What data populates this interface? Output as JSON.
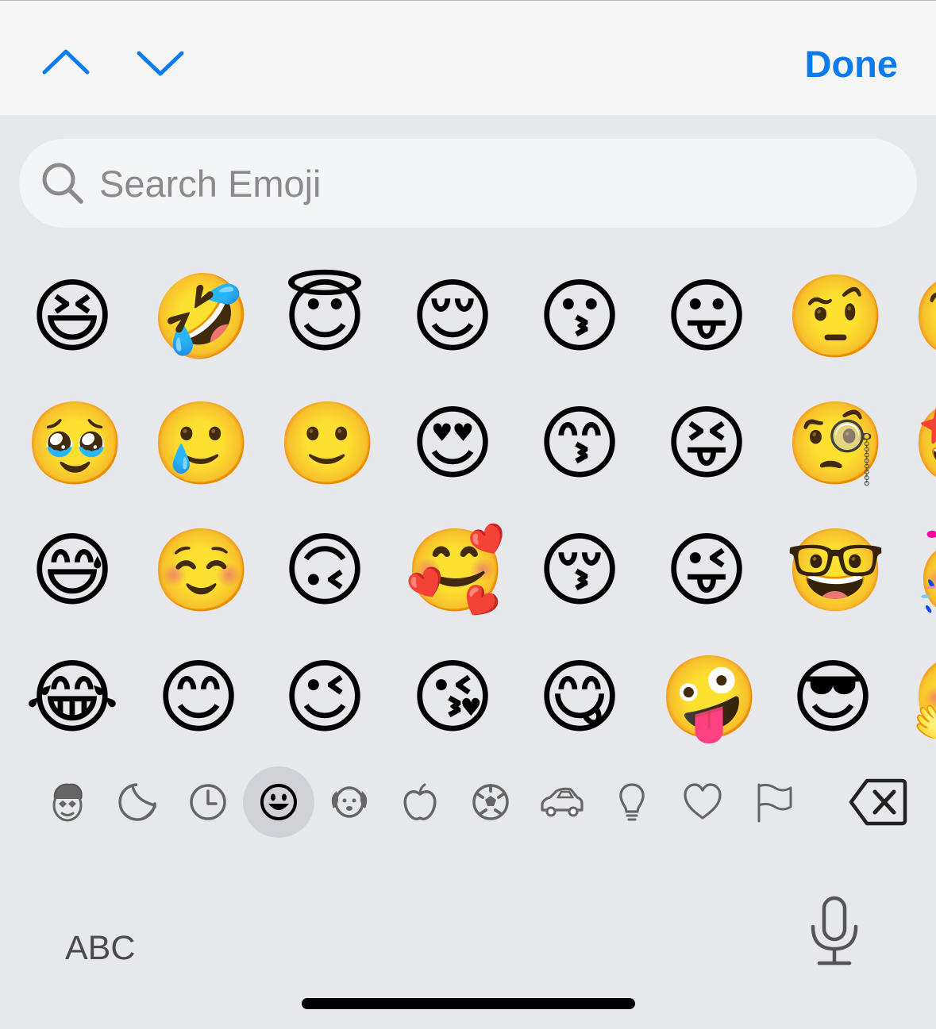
{
  "toolbar": {
    "prev_icon": "chevron-up-icon",
    "next_icon": "chevron-down-icon",
    "done_label": "Done",
    "accent_color": "#0a7cf0"
  },
  "search": {
    "placeholder": "Search Emoji",
    "icon": "magnifying-glass-icon"
  },
  "emoji_rows": [
    [
      "😆",
      "🤣",
      "😇",
      "😌",
      "😗",
      "😛",
      "🤨",
      "🧐"
    ],
    [
      "🥹",
      "🥲",
      "🙂",
      "😍",
      "😙",
      "😝",
      "🧐",
      "🤩"
    ],
    [
      "😅",
      "☺️",
      "🙃",
      "🥰",
      "😚",
      "😜",
      "🤓",
      "🥳"
    ],
    [
      "😂",
      "😊",
      "😉",
      "😘",
      "😋",
      "🤪",
      "😎",
      "🤗"
    ]
  ],
  "categories": [
    {
      "name": "memoji-stickers-icon",
      "selected": false
    },
    {
      "name": "stickers-icon",
      "selected": false
    },
    {
      "name": "recents-clock-icon",
      "selected": false
    },
    {
      "name": "smileys-icon",
      "selected": true
    },
    {
      "name": "animals-dog-icon",
      "selected": false
    },
    {
      "name": "food-apple-icon",
      "selected": false
    },
    {
      "name": "activity-soccer-icon",
      "selected": false
    },
    {
      "name": "travel-car-icon",
      "selected": false
    },
    {
      "name": "objects-lightbulb-icon",
      "selected": false
    },
    {
      "name": "symbols-heart-icon",
      "selected": false
    },
    {
      "name": "flags-icon",
      "selected": false
    }
  ],
  "bottom": {
    "abc_label": "ABC",
    "delete_icon": "backspace-icon",
    "mic_icon": "microphone-icon"
  }
}
